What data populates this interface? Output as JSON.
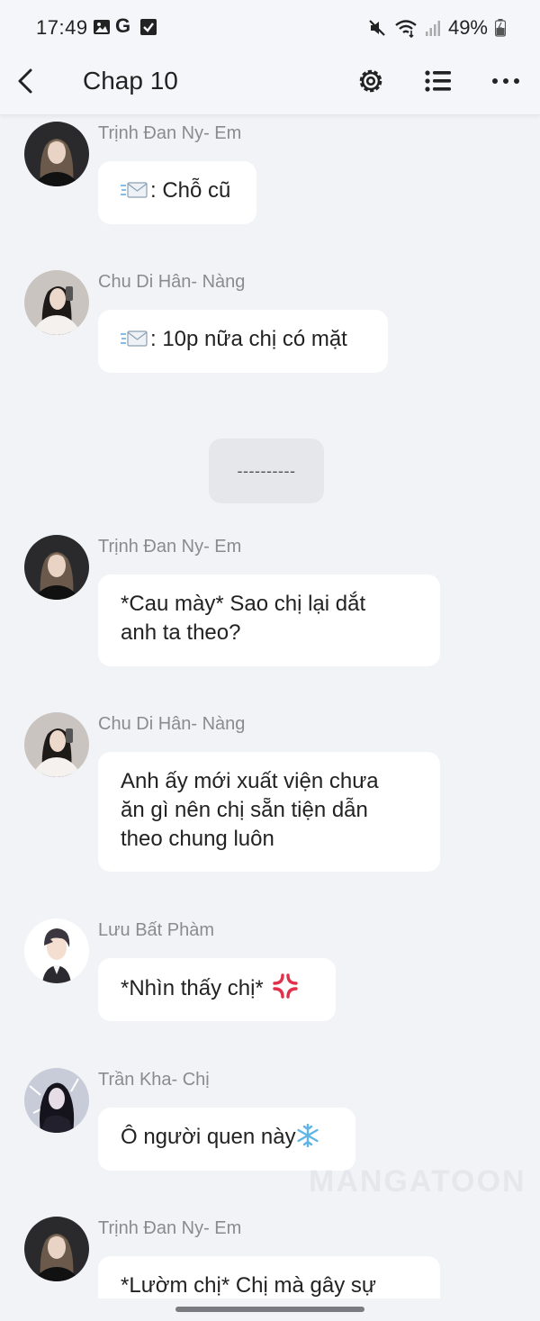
{
  "status_bar": {
    "time": "17:49",
    "battery": "49%",
    "left_icons": [
      "gallery-icon",
      "google-icon",
      "checkbox-icon"
    ],
    "right_icons": [
      "mute-icon",
      "wifi-icon",
      "signal-icon",
      "battery-icon"
    ],
    "google_letter": "G"
  },
  "header": {
    "title": "Chap 10",
    "buttons": [
      "back-icon",
      "settings-icon",
      "list-icon",
      "more-icon"
    ]
  },
  "messages": [
    {
      "sender": "Trịnh Đan Ny- Em",
      "text": ": Chỗ cũ",
      "prefix_icon": "envelope-emoji"
    },
    {
      "sender": "Chu Di Hân- Nàng",
      "text": ": 10p nữa chị có mặt",
      "prefix_icon": "envelope-emoji"
    },
    {
      "sender": "Trịnh Đan Ny- Em",
      "line1": "*Cau mày* Sao chị lại dắt",
      "line2": "anh ta theo?"
    },
    {
      "sender": "Chu Di Hân- Nàng",
      "line1": "Anh ấy mới xuất viện chưa",
      "line2": "ăn gì nên chị sẵn tiện dẫn",
      "line3": "theo chung luôn"
    },
    {
      "sender": "Lưu Bất Phàm",
      "text": "*Nhìn thấy chị* ",
      "suffix_icon": "anger-emoji"
    },
    {
      "sender": "Trần Kha- Chị",
      "text": "Ô người quen này",
      "suffix_icon": "snowflake-emoji"
    },
    {
      "sender": "Trịnh Đan Ny- Em",
      "text": "*Lườm chị* Chị mà gây sự"
    }
  ],
  "separator": "----------",
  "watermark": "MANGATOON",
  "colors": {
    "background": "#f2f3f7",
    "bubble": "#ffffff",
    "sender_name": "#8a8b90",
    "separator_bg": "#e6e7eb"
  }
}
